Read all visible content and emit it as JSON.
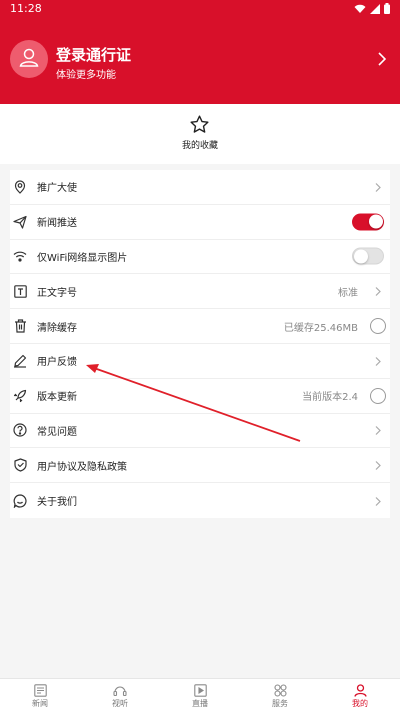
{
  "status_bar": {
    "time": "11:28",
    "icons": [
      "wifi-icon",
      "signal-icon",
      "battery-icon"
    ]
  },
  "profile": {
    "title": "登录通行证",
    "subtitle": "体验更多功能",
    "avatar_icon": "user-icon",
    "chevron_icon": "chevron-right-icon"
  },
  "favorites": {
    "label": "我的收藏",
    "icon": "star-icon"
  },
  "settings": {
    "items": [
      {
        "label": "推广大使",
        "icon": "location-pin-icon",
        "trailing": "chevron"
      },
      {
        "label": "新闻推送",
        "icon": "paper-plane-icon",
        "trailing": "toggle",
        "toggle_on": true
      },
      {
        "label": "仅WiFi网络显示图片",
        "icon": "wifi-icon",
        "trailing": "toggle",
        "toggle_on": false
      },
      {
        "label": "正文字号",
        "icon": "text-size-icon",
        "trailing": "chevron",
        "value": "标准"
      },
      {
        "label": "清除缓存",
        "icon": "trash-icon",
        "trailing": "circle",
        "value": "已缓存25.46MB"
      },
      {
        "label": "用户反馈",
        "icon": "pen-icon",
        "trailing": "chevron"
      },
      {
        "label": "版本更新",
        "icon": "rocket-icon",
        "trailing": "circle",
        "value": "当前版本2.4"
      },
      {
        "label": "常见问题",
        "icon": "question-icon",
        "trailing": "chevron"
      },
      {
        "label": "用户协议及隐私政策",
        "icon": "shield-icon",
        "trailing": "chevron"
      },
      {
        "label": "关于我们",
        "icon": "chat-icon",
        "trailing": "chevron"
      }
    ]
  },
  "bottom_nav": {
    "items": [
      {
        "label": "新闻",
        "icon": "news-icon",
        "active": false
      },
      {
        "label": "视听",
        "icon": "audio-video-icon",
        "active": false
      },
      {
        "label": "直播",
        "icon": "live-icon",
        "active": false
      },
      {
        "label": "服务",
        "icon": "grid-icon",
        "active": false
      },
      {
        "label": "我的",
        "icon": "profile-icon",
        "active": true
      }
    ]
  },
  "colors": {
    "brand": "#d8102a",
    "annotation": "#e0202a"
  }
}
